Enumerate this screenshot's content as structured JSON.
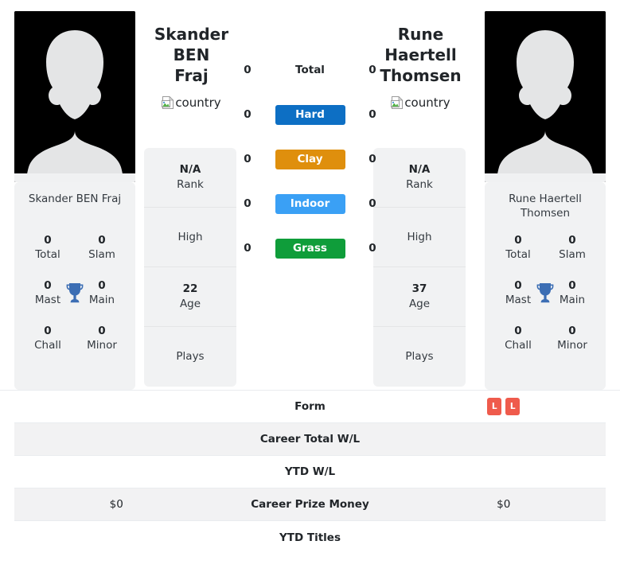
{
  "players": {
    "left": {
      "name": "Skander BEN Fraj",
      "display_name_lines": [
        "Skander BEN",
        "Fraj"
      ],
      "country_alt": "country",
      "avatar": "player-silhouette",
      "titles": [
        {
          "num": "0",
          "label": "Total"
        },
        {
          "num": "0",
          "label": "Slam"
        },
        {
          "num": "0",
          "label": "Mast"
        },
        {
          "num": "0",
          "label": "Main"
        },
        {
          "num": "0",
          "label": "Chall"
        },
        {
          "num": "0",
          "label": "Minor"
        }
      ],
      "info": [
        {
          "value": "N/A",
          "caption": "Rank"
        },
        {
          "value": "",
          "caption": "High"
        },
        {
          "value": "22",
          "caption": "Age"
        },
        {
          "value": "",
          "caption": "Plays"
        }
      ],
      "h2h": {
        "total": "0",
        "hard": "0",
        "clay": "0",
        "indoor": "0",
        "grass": "0"
      },
      "table": {
        "form": [],
        "career_total_wl": "",
        "ytd_wl": "",
        "career_prize_money": "$0",
        "ytd_titles": ""
      }
    },
    "right": {
      "name": "Rune Haertell Thomsen",
      "display_name_lines": [
        "Rune Haertell",
        "Thomsen"
      ],
      "country_alt": "country",
      "avatar": "player-silhouette",
      "titles": [
        {
          "num": "0",
          "label": "Total"
        },
        {
          "num": "0",
          "label": "Slam"
        },
        {
          "num": "0",
          "label": "Mast"
        },
        {
          "num": "0",
          "label": "Main"
        },
        {
          "num": "0",
          "label": "Chall"
        },
        {
          "num": "0",
          "label": "Minor"
        }
      ],
      "info": [
        {
          "value": "N/A",
          "caption": "Rank"
        },
        {
          "value": "",
          "caption": "High"
        },
        {
          "value": "37",
          "caption": "Age"
        },
        {
          "value": "",
          "caption": "Plays"
        }
      ],
      "h2h": {
        "total": "0",
        "hard": "0",
        "clay": "0",
        "indoor": "0",
        "grass": "0"
      },
      "table": {
        "form": [
          "L",
          "L"
        ],
        "career_total_wl": "",
        "ytd_wl": "",
        "career_prize_money": "$0",
        "ytd_titles": ""
      }
    }
  },
  "surfaces": [
    {
      "key": "total",
      "label": "Total",
      "color": "transparent"
    },
    {
      "key": "hard",
      "label": "Hard",
      "color": "#0d6fc4"
    },
    {
      "key": "clay",
      "label": "Clay",
      "color": "#df8f0d"
    },
    {
      "key": "indoor",
      "label": "Indoor",
      "color": "#3aa0f5"
    },
    {
      "key": "grass",
      "label": "Grass",
      "color": "#0f9d3a"
    }
  ],
  "stat_table_rows": [
    {
      "key": "form",
      "label": "Form"
    },
    {
      "key": "career_total_wl",
      "label": "Career Total W/L"
    },
    {
      "key": "ytd_wl",
      "label": "YTD W/L"
    },
    {
      "key": "career_prize_money",
      "label": "Career Prize Money"
    },
    {
      "key": "ytd_titles",
      "label": "YTD Titles"
    }
  ],
  "colors": {
    "hard": "#0d6fc4",
    "clay": "#df8f0d",
    "indoor": "#3aa0f5",
    "grass": "#0f9d3a",
    "loss_badge": "#ef5b4c",
    "trophy": "#3c6eb4",
    "card_bg": "#f1f2f3"
  }
}
